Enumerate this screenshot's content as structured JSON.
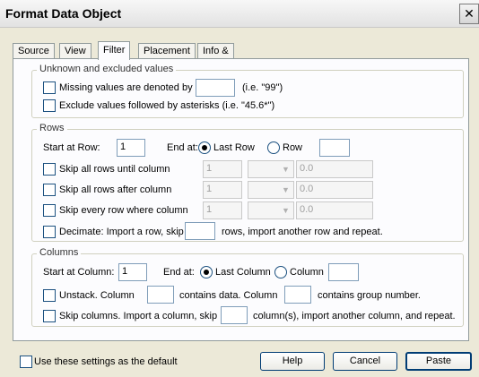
{
  "window": {
    "title": "Format Data Object",
    "close_glyph": "✕"
  },
  "tabs": [
    {
      "label": "Source"
    },
    {
      "label": "View"
    },
    {
      "label": "Filter",
      "active": true
    },
    {
      "label": "Placement"
    },
    {
      "label": "Info & Notes"
    }
  ],
  "unknown": {
    "legend": "Unknown and excluded values",
    "missing_label": "Missing values are denoted by",
    "missing_hint": "(i.e. \"99\")",
    "exclude_label": "Exclude values followed by asterisks (i.e. \"45.6*\")"
  },
  "rows": {
    "legend": "Rows",
    "start_label": "Start at Row:",
    "start_value": "1",
    "end_label": "End at:",
    "last_row_label": "Last Row",
    "row_label": "Row",
    "skip_until_label": "Skip all rows until column",
    "skip_after_label": "Skip all rows after column",
    "skip_every_label": "Skip every row where column",
    "skip_col_value": "1",
    "skip_num_value": "0.0",
    "decimate_label": "Decimate: Import a row, skip",
    "decimate_tail": "rows, import another row and repeat."
  },
  "columns": {
    "legend": "Columns",
    "start_label": "Start at Column:",
    "start_value": "1",
    "end_label": "End at:",
    "last_col_label": "Last Column",
    "col_label": "Column",
    "unstack_label": "Unstack.  Column",
    "contains_data": "contains data.  Column",
    "contains_group": "contains group  number.",
    "skip_cols_label": "Skip columns. Import a column, skip",
    "skip_cols_tail": "column(s), import another column, and repeat."
  },
  "footer": {
    "default_label": "Use these settings as the default",
    "help": "Help",
    "cancel": "Cancel",
    "paste": "Paste"
  }
}
